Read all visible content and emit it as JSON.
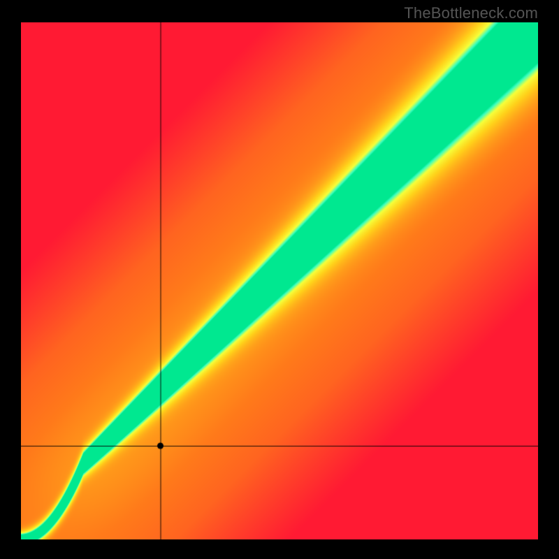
{
  "watermark": "TheBottleneck.com",
  "chart_data": {
    "type": "heatmap",
    "title": "",
    "xlabel": "",
    "ylabel": "",
    "xlim": [
      0,
      100
    ],
    "ylim": [
      0,
      100
    ],
    "crosshair": {
      "x": 27,
      "y": 18
    },
    "point": {
      "x": 27,
      "y": 18
    },
    "ridge": {
      "description": "green optimal band running diagonally; peak line approx y = 0.95*x + 5 for x>15, curving toward origin below",
      "slope": 0.97,
      "intercept": 3,
      "width_top": 14,
      "width_bottom": 2
    },
    "color_stops": [
      {
        "value": 0.0,
        "color": "#ff1a33"
      },
      {
        "value": 0.45,
        "color": "#ff7a1a"
      },
      {
        "value": 0.7,
        "color": "#ffd21a"
      },
      {
        "value": 0.85,
        "color": "#f6ff3a"
      },
      {
        "value": 0.95,
        "color": "#3affc0"
      },
      {
        "value": 1.0,
        "color": "#00e890"
      }
    ]
  }
}
